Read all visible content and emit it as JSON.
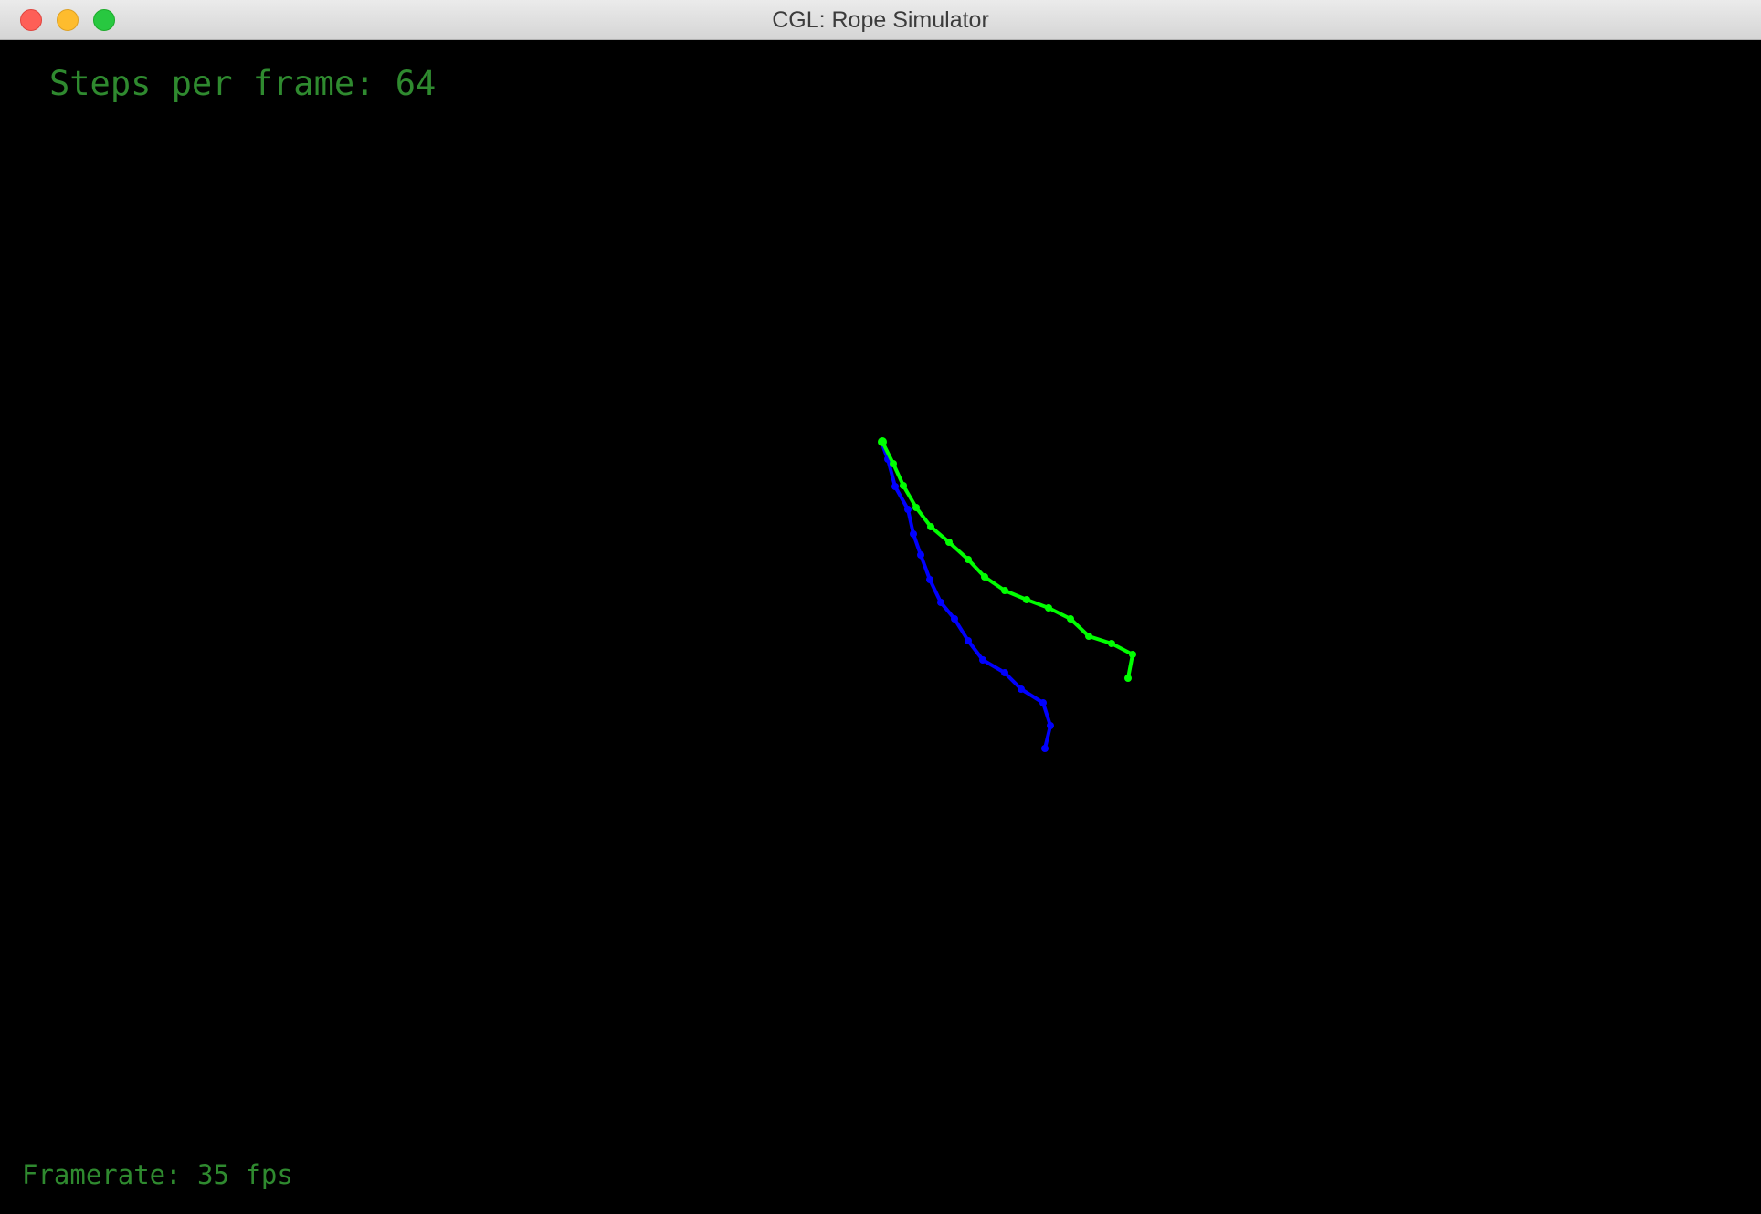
{
  "window": {
    "title": "CGL: Rope Simulator"
  },
  "hud": {
    "steps_per_frame": "Steps per frame: 64",
    "framerate": "Framerate: 35 fps"
  },
  "colors": {
    "background": "#000000",
    "hud_text": "#2f8a2f",
    "rope_green": "#00ff00",
    "rope_blue": "#0000ff"
  }
}
